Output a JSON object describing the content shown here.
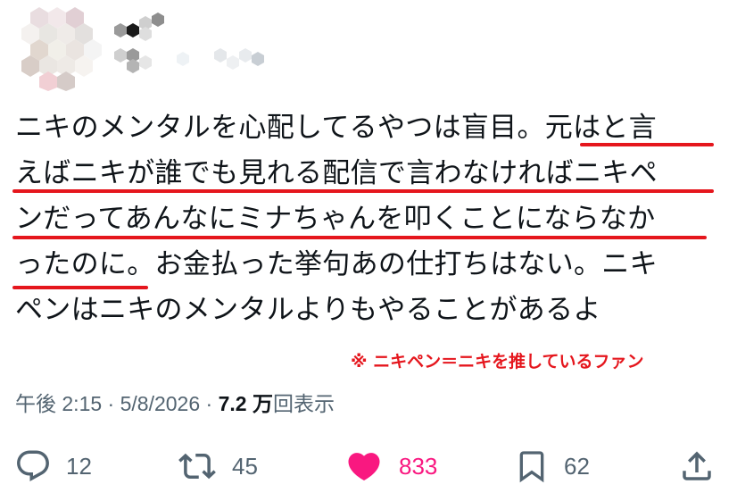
{
  "tweet": {
    "lines": [
      "ニキのメンタルを心配してるやつは盲目。元はと言",
      "えばニキが誰でも見れる配信で言わなければニキペ",
      "ンだってあんなにミナちゃんを叩くことにならなか",
      "ったのに。お金払った挙句あの仕打ちはない。ニキ",
      "ペンはニキのメンタルよりもやることがあるよ"
    ],
    "annotation": "※ ニキペン＝ニキを推しているファン"
  },
  "meta": {
    "time": "午後 2:15",
    "sep1": " · ",
    "date": "5/8/2026",
    "sep2": " · ",
    "views_count": "7.2 万",
    "views_label": "回表示"
  },
  "actions": {
    "reply": {
      "icon": "reply-icon",
      "count": "12"
    },
    "retweet": {
      "icon": "retweet-icon",
      "count": "45"
    },
    "like": {
      "icon": "heart-icon",
      "count": "833",
      "color": "#f91880"
    },
    "bookmark": {
      "icon": "bookmark-icon",
      "count": "62"
    },
    "share": {
      "icon": "share-icon"
    }
  },
  "colors": {
    "accent_red": "#e5161d",
    "muted": "#536471",
    "text": "#0f1419"
  }
}
